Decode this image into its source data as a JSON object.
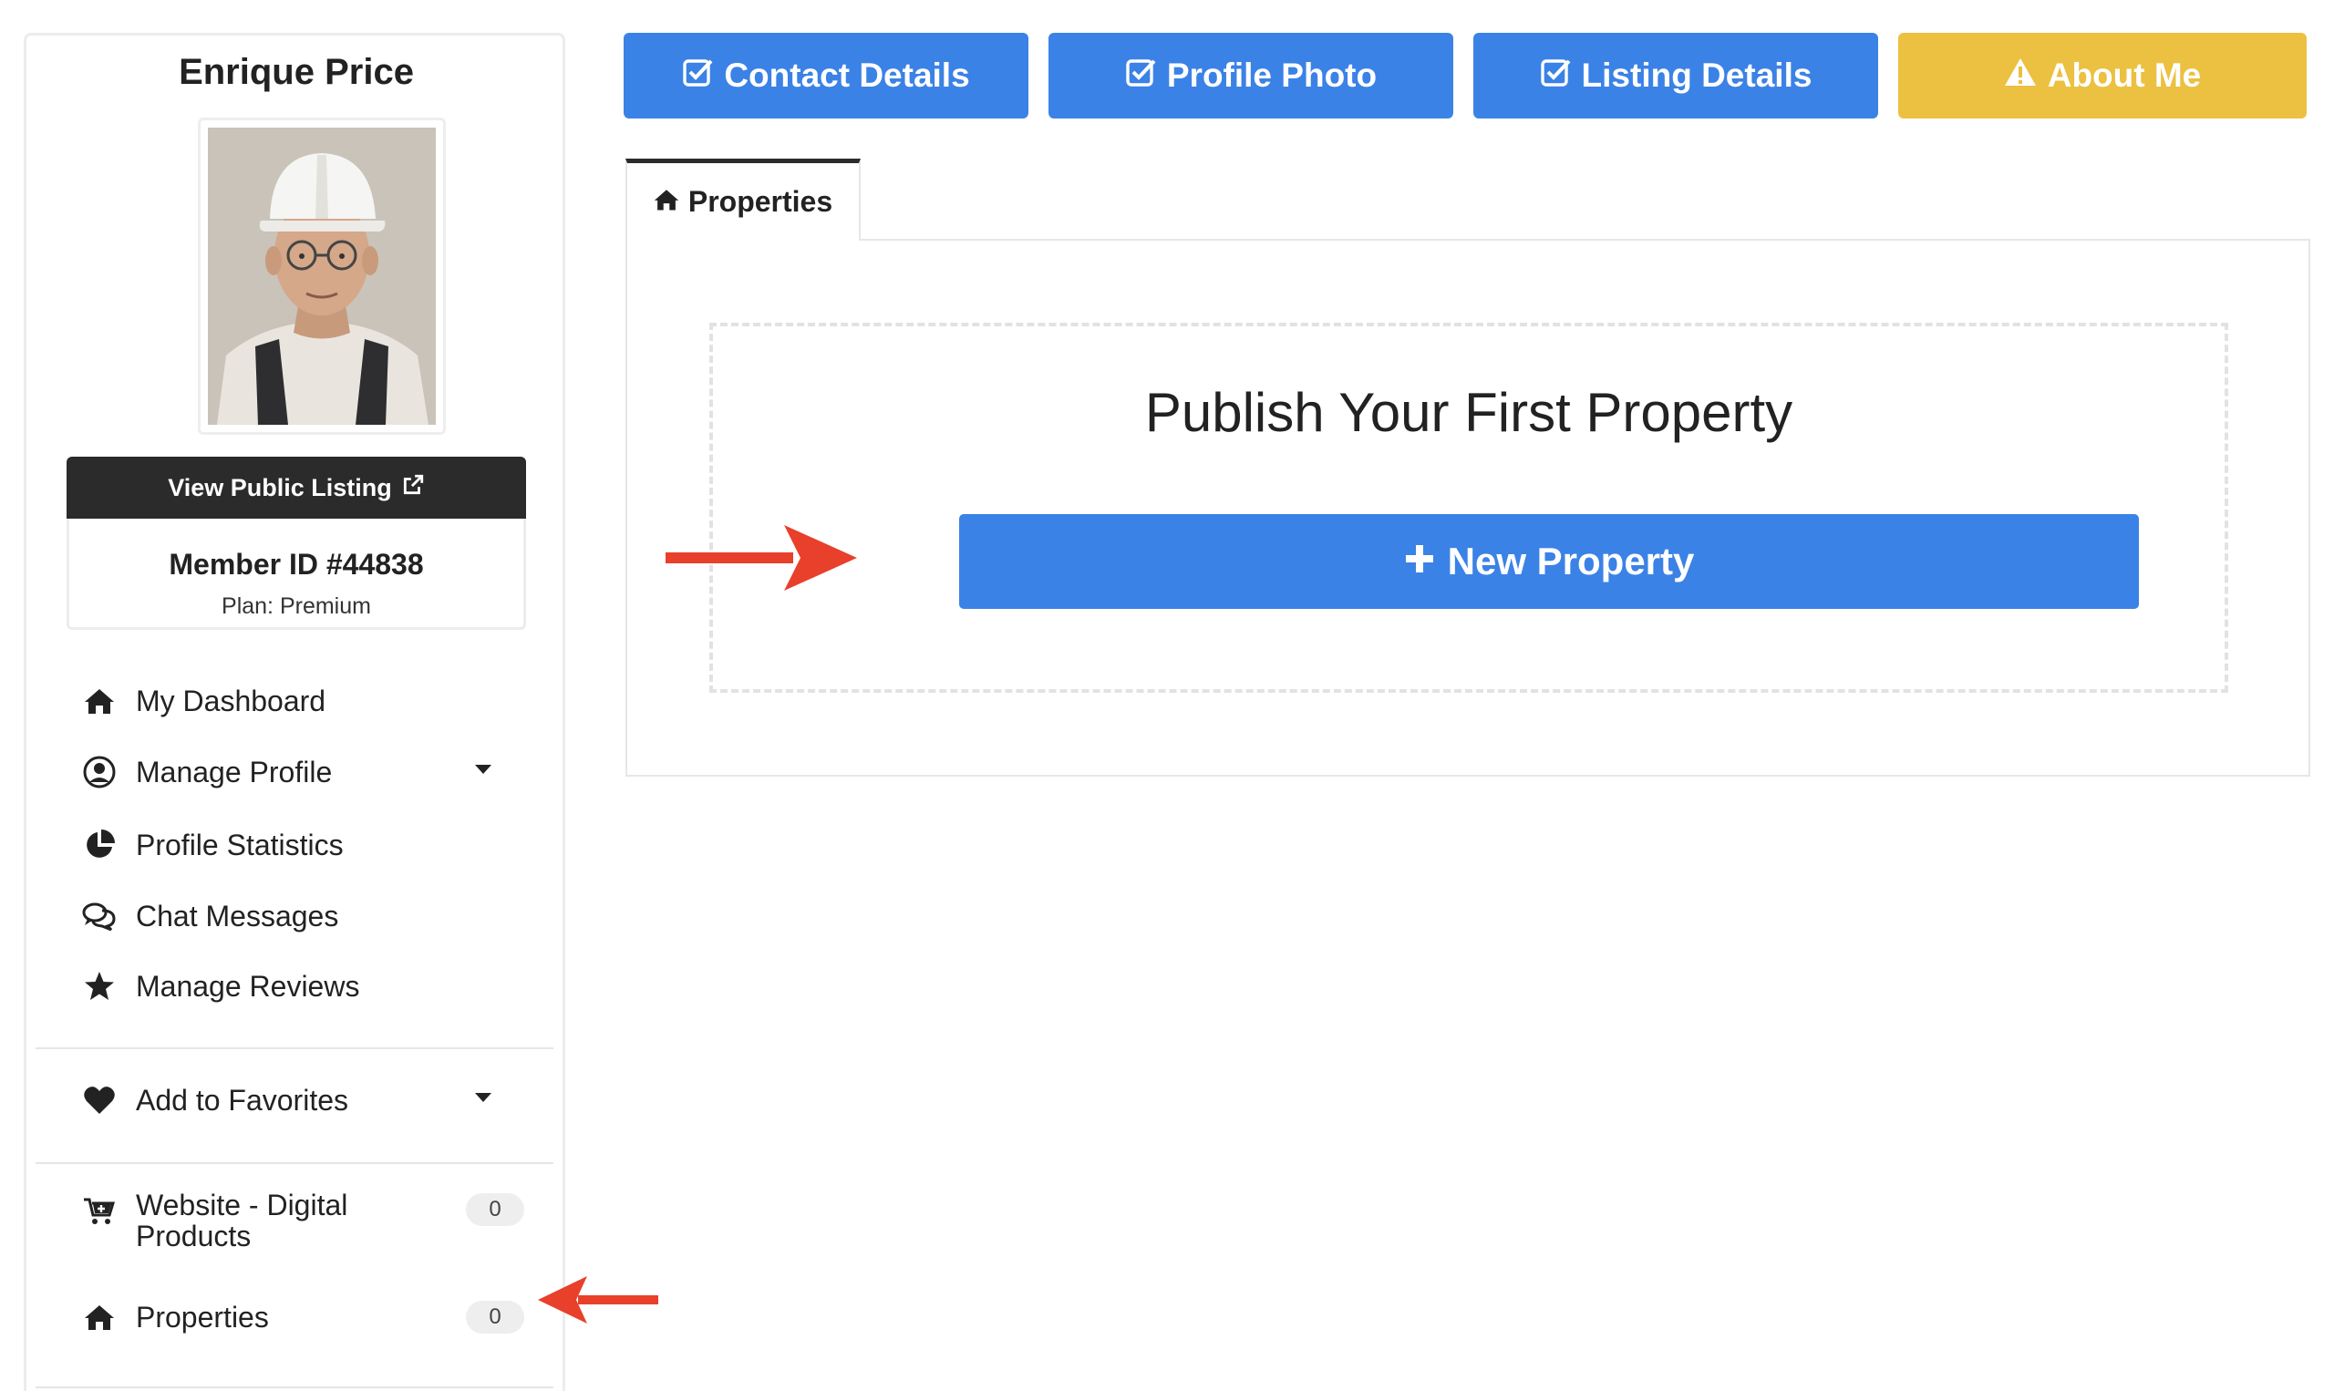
{
  "profile": {
    "name": "Enrique Price",
    "view_public_listing": "View Public Listing",
    "member_id": "Member ID #44838",
    "plan": "Plan: Premium"
  },
  "sidebar": {
    "items": [
      {
        "label": "My Dashboard",
        "icon": "home-icon"
      },
      {
        "label": "Manage Profile",
        "icon": "user-circle-icon",
        "has_dropdown": true
      },
      {
        "label": "Profile Statistics",
        "icon": "pie-chart-icon"
      },
      {
        "label": "Chat Messages",
        "icon": "chat-bubbles-icon"
      },
      {
        "label": "Manage Reviews",
        "icon": "star-icon"
      },
      {
        "label": "Add to Favorites",
        "icon": "heart-icon",
        "has_dropdown": true
      },
      {
        "label_line1": "Website - Digital",
        "label_line2": "Products",
        "icon": "cart-icon",
        "count": "0"
      },
      {
        "label": "Properties",
        "icon": "home-icon",
        "count": "0"
      }
    ]
  },
  "steps": [
    {
      "label": "Contact Details",
      "status": "complete",
      "icon": "check-square-icon",
      "color": "#3b82e6"
    },
    {
      "label": "Profile Photo",
      "status": "complete",
      "icon": "check-square-icon",
      "color": "#3b82e6"
    },
    {
      "label": "Listing Details",
      "status": "complete",
      "icon": "check-square-icon",
      "color": "#3b82e6"
    },
    {
      "label": "About Me",
      "status": "warning",
      "icon": "warning-icon",
      "color": "#ecc040"
    }
  ],
  "tabs": [
    {
      "label": "Properties",
      "icon": "home-icon",
      "active": true
    }
  ],
  "main": {
    "empty_title": "Publish Your First Property",
    "new_property_label": "New Property"
  },
  "colors": {
    "primary": "#3b82e6",
    "warning": "#ecc040",
    "dark": "#2b2b2b",
    "annotation_arrow": "#e8402b"
  }
}
